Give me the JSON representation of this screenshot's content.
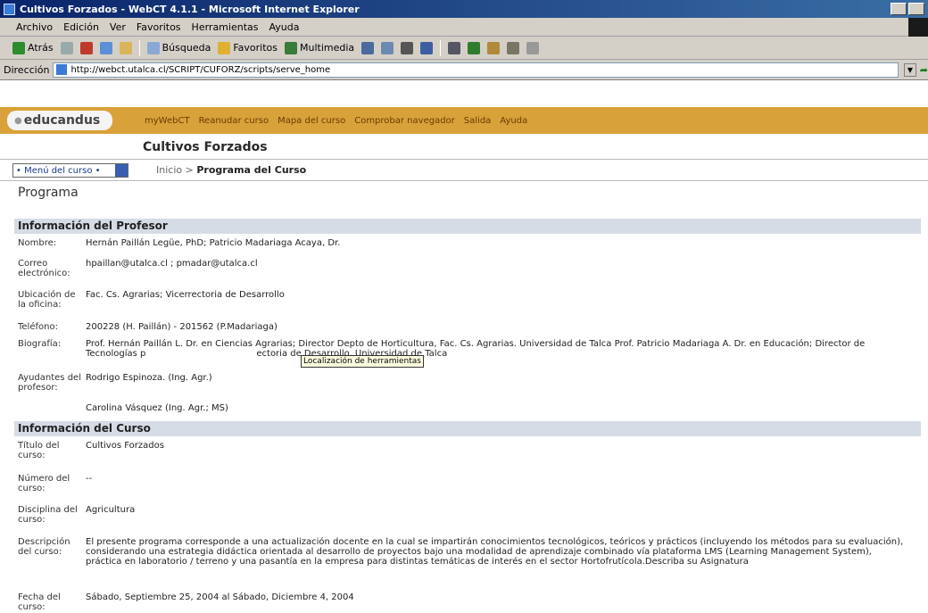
{
  "window": {
    "title": "Cultivos Forzados - WebCT 4.1.1 - Microsoft Internet Explorer"
  },
  "menubar": {
    "items": [
      "Archivo",
      "Edición",
      "Ver",
      "Favoritos",
      "Herramientas",
      "Ayuda"
    ]
  },
  "toolbar": {
    "back": "Atrás",
    "search": "Búsqueda",
    "favorites": "Favoritos",
    "multimedia": "Multimedia"
  },
  "address": {
    "label": "Dirección",
    "url": "http://webct.utalca.cl/SCRIPT/CUFORZ/scripts/serve_home"
  },
  "webct": {
    "logo": "educandus",
    "nav": [
      "myWebCT",
      "Reanudar curso",
      "Mapa del curso",
      "Comprobar navegador",
      "Salida",
      "Ayuda"
    ],
    "course_title": "Cultivos Forzados",
    "course_menu": "• Menú del curso •",
    "breadcrumb_home": "Inicio",
    "breadcrumb_sep": ">",
    "breadcrumb_current": "Programa del Curso",
    "page_title": "Programa"
  },
  "sections": {
    "profesor": "Información del Profesor",
    "curso": "Información del Curso"
  },
  "profesor": {
    "nombre_label": "Nombre:",
    "nombre": "Hernán Paillán Legüe, PhD; Patricio Madariaga Acaya, Dr.",
    "correo_label": "Correo electrónico:",
    "correo": "hpaillan@utalca.cl ; pmadar@utalca.cl",
    "ubicacion_label": "Ubicación de la oficina:",
    "ubicacion": "Fac. Cs. Agrarias; Vicerrectoria de Desarrollo",
    "telefono_label": "Teléfono:",
    "telefono": "200228 (H. Paillán) - 201562 (P.Madariaga)",
    "biografia_label": "Biografía:",
    "biografia": "Prof. Hernán Paillán L. Dr. en Ciencias Agrarias; Director Depto de Horticultura, Fac. Cs. Agrarias. Universidad de Talca Prof. Patricio Madariaga A. Dr. en Educación; Director de Tecnologías p                                       ectoria de Desarrollo. Universidad de Talca",
    "ayudantes_label": "Ayudantes del profesor:",
    "ayudante1": "Rodrigo Espinoza. (Ing. Agr.)",
    "ayudante2": "Carolina Vásquez (Ing. Agr.; MS)"
  },
  "curso": {
    "titulo_label": "Título del curso:",
    "titulo": "Cultivos Forzados",
    "numero_label": "Número del curso:",
    "numero": "--",
    "disciplina_label": "Disciplina del curso:",
    "disciplina": "Agricultura",
    "descripcion_label": "Descripción del curso:",
    "descripcion": "El presente programa corresponde a una actualización docente en la cual se impartirán conocimientos tecnológicos, teóricos y prácticos (incluyendo los métodos para su evaluación), considerando una estrategia didáctica orientada al desarrollo de proyectos bajo una modalidad de aprendizaje combinado vía plataforma LMS (Learning Management System), práctica en laboratorio / terreno y una pasantía en la empresa para distintas temáticas de interés en el sector Hortofrutícola.Describa su Asignatura",
    "fecha_label": "Fecha del curso:",
    "fecha": "Sábado, Septiembre 25, 2004 al Sábado, Diciembre 4, 2004"
  },
  "tooltip": "Localización de herramientas"
}
